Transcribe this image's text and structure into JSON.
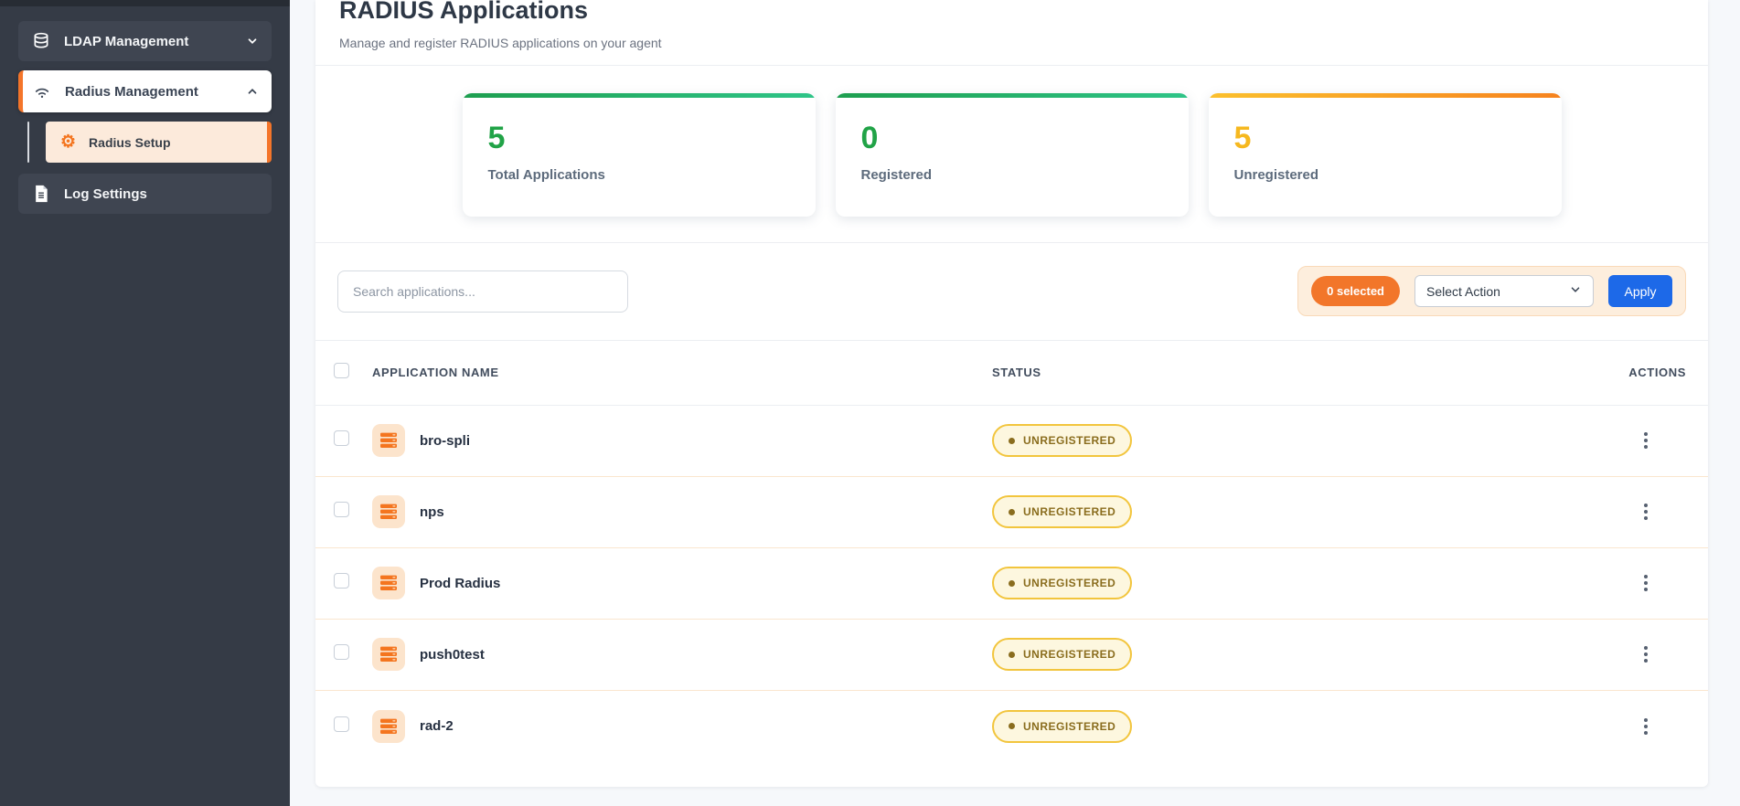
{
  "sidebar": {
    "ldap": {
      "label": "LDAP Management"
    },
    "radius_management": {
      "label": "Radius Management"
    },
    "radius_setup": {
      "label": "Radius Setup"
    },
    "log_settings": {
      "label": "Log Settings"
    }
  },
  "header": {
    "title": "RADIUS Applications",
    "subtitle": "Manage and register RADIUS applications on your agent"
  },
  "stats": {
    "cards": [
      {
        "value": "5",
        "label": "Total Applications"
      },
      {
        "value": "0",
        "label": "Registered"
      },
      {
        "value": "5",
        "label": "Unregistered"
      }
    ]
  },
  "toolbar": {
    "search_placeholder": "Search applications...",
    "selected_badge": "0 selected",
    "action_select": "Select Action",
    "apply_label": "Apply"
  },
  "table": {
    "columns": [
      "APPLICATION NAME",
      "STATUS",
      "ACTIONS"
    ],
    "rows": [
      {
        "name": "bro-spli",
        "status": "UNREGISTERED"
      },
      {
        "name": "nps",
        "status": "UNREGISTERED"
      },
      {
        "name": "Prod Radius",
        "status": "UNREGISTERED"
      },
      {
        "name": "push0test",
        "status": "UNREGISTERED"
      },
      {
        "name": "rad-2",
        "status": "UNREGISTERED"
      }
    ]
  },
  "colors": {
    "accent_orange": "#f4752a",
    "success_green": "#21a347",
    "warning_amber": "#f6b81f",
    "apply_blue": "#1d69e8",
    "sidebar_bg": "#353b46",
    "badge_bg": "#fdf7df",
    "badge_border": "#f2c53d",
    "badge_text": "#8a6d1e",
    "row_divider": "#fae6cf"
  }
}
